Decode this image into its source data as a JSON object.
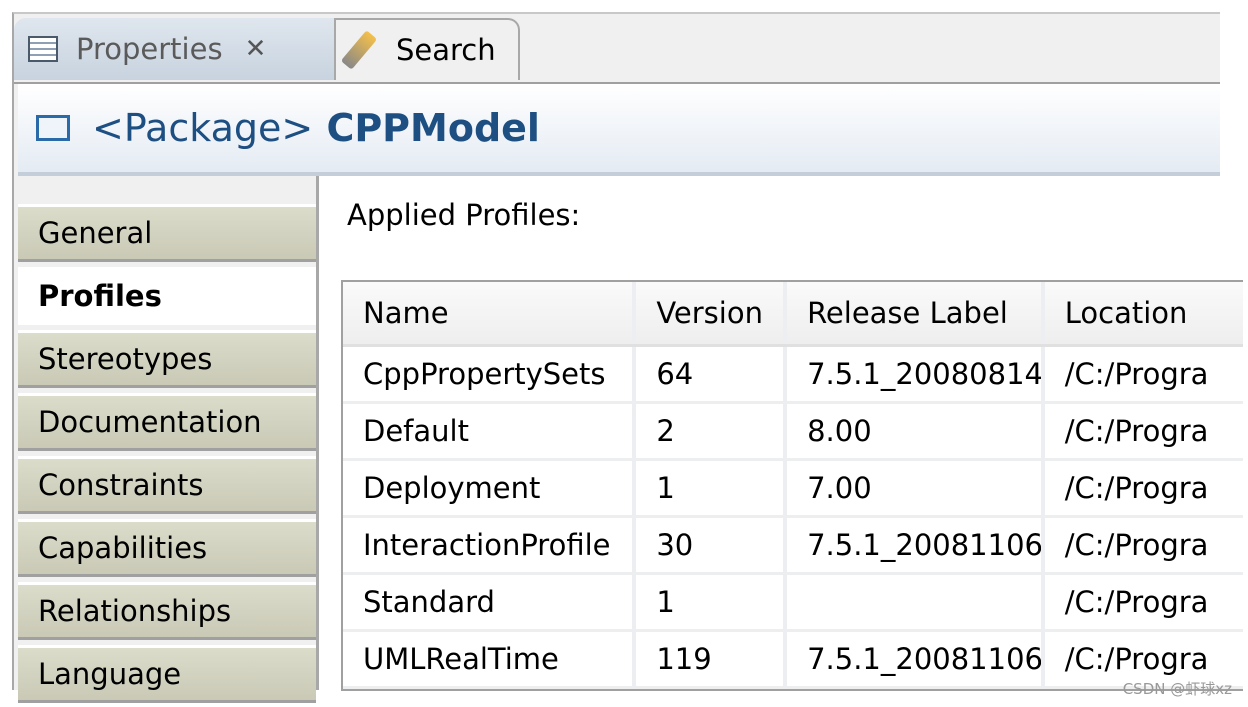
{
  "tabs": [
    {
      "label": "Properties",
      "icon": "properties-table-icon",
      "active": true
    },
    {
      "label": "Search",
      "icon": "search-flashlight-icon",
      "active": false
    }
  ],
  "header": {
    "prefix": "<Package>",
    "name": "CPPModel",
    "icon": "folder-icon"
  },
  "sidebar": {
    "items": [
      {
        "label": "General"
      },
      {
        "label": "Profiles"
      },
      {
        "label": "Stereotypes"
      },
      {
        "label": "Documentation"
      },
      {
        "label": "Constraints"
      },
      {
        "label": "Capabilities"
      },
      {
        "label": "Relationships"
      },
      {
        "label": "Language"
      }
    ],
    "selected": "Profiles"
  },
  "main": {
    "section_label": "Applied Profiles:",
    "columns": [
      "Name",
      "Version",
      "Release Label",
      "Location"
    ],
    "rows": [
      [
        "CppPropertySets",
        "64",
        "7.5.1_20080814",
        "/C:/Progra"
      ],
      [
        "Default",
        "2",
        "8.00",
        "/C:/Progra"
      ],
      [
        "Deployment",
        "1",
        "7.00",
        "/C:/Progra"
      ],
      [
        "InteractionProfile",
        "30",
        "7.5.1_20081106",
        "/C:/Progra"
      ],
      [
        "Standard",
        "1",
        "",
        "/C:/Progra"
      ],
      [
        "UMLRealTime",
        "119",
        "7.5.1_20081106",
        "/C:/Progra"
      ]
    ]
  },
  "watermark": "CSDN @虾球xz"
}
